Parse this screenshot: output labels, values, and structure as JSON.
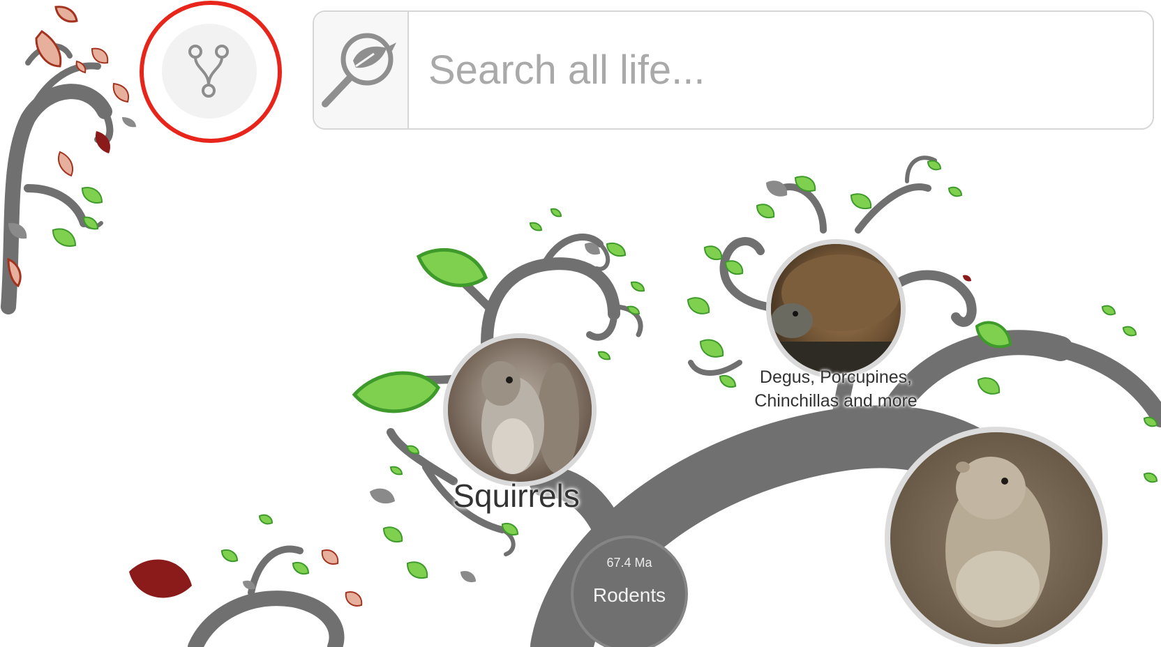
{
  "toolbar": {
    "tree_view_button_icon": "git-fork-icon"
  },
  "search": {
    "icon": "leaf-magnifier-icon",
    "placeholder": "Search all life..."
  },
  "tree": {
    "nodes": [
      {
        "label": "Squirrels",
        "image": "squirrel-photo"
      },
      {
        "label": "Degus, Porcupines, Chinchillas and more",
        "image": "degu-photo"
      },
      {
        "image": "ground-squirrel-photo"
      }
    ],
    "root": {
      "age": "67.4 Ma",
      "label": "Rodents"
    }
  },
  "colors": {
    "branch": "#707070",
    "leaf_green": "#7fd04f",
    "leaf_green_border": "#3e9a2a",
    "leaf_dark_red": "#8b1a1a",
    "leaf_pink": "#e7b09c",
    "leaf_pink_border": "#a3331f",
    "highlight_ring": "#e8251a"
  }
}
